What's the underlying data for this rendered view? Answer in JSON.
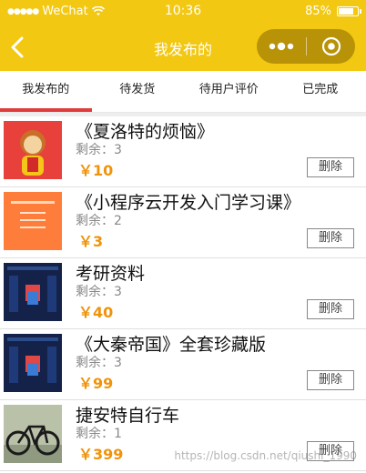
{
  "status_bar": {
    "signal_dots": "●●●●●",
    "carrier": "WeChat",
    "time": "10:36",
    "battery_text": "85%",
    "battery_level": 0.85
  },
  "nav": {
    "title": "我发布的",
    "icons": {
      "back": "chevron-left-icon",
      "more": "more-dots-icon",
      "close": "target-circle-icon"
    }
  },
  "tabs": [
    {
      "label": "我发布的",
      "active": true
    },
    {
      "label": "待发货",
      "active": false
    },
    {
      "label": "待用户评价",
      "active": false
    },
    {
      "label": "已完成",
      "active": false
    }
  ],
  "items": [
    {
      "title": "《夏洛特的烦恼》",
      "remain": "剩余：3",
      "price": "￥10",
      "delete_label": "删除"
    },
    {
      "title": "《小程序云开发入门学习课》",
      "remain": "剩余：2",
      "price": "￥3",
      "delete_label": "删除"
    },
    {
      "title": "考研资料",
      "remain": "剩余：3",
      "price": "￥40",
      "delete_label": "删除"
    },
    {
      "title": "《大秦帝国》全套珍藏版",
      "remain": "剩余：3",
      "price": "￥99",
      "delete_label": "删除"
    },
    {
      "title": "捷安特自行车",
      "remain": "剩余：1",
      "price": "￥399",
      "delete_label": "删除"
    }
  ],
  "watermark": "https://blog.csdn.net/qiushi_1990",
  "colors": {
    "header": "#f2c812",
    "capsule": "#b89207",
    "price": "#f0930a",
    "tab_indicator": "#e03c3c"
  }
}
